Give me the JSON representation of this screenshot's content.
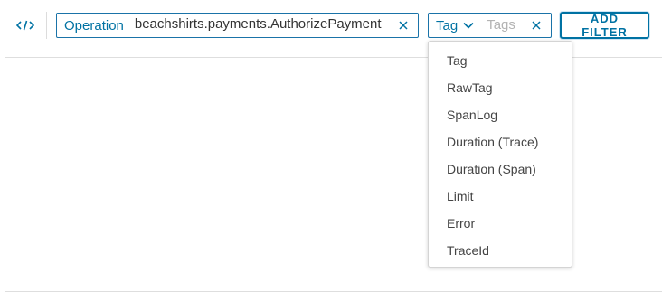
{
  "toolbar": {
    "code_icon": "code-brackets-icon",
    "operation_chip": {
      "key": "Operation",
      "value": "beachshirts.payments.AuthorizePayment",
      "close_icon": "close-icon"
    },
    "tag_chip": {
      "key": "Tag",
      "dropdown_icon": "chevron-down-icon",
      "input_value": "",
      "input_placeholder": "Tags",
      "close_icon": "close-icon"
    },
    "add_filter_label": "ADD FILTER"
  },
  "dropdown": {
    "items": [
      {
        "label": "Tag"
      },
      {
        "label": "RawTag"
      },
      {
        "label": "SpanLog"
      },
      {
        "label": "Duration (Trace)"
      },
      {
        "label": "Duration (Span)"
      },
      {
        "label": "Limit"
      },
      {
        "label": "Error"
      },
      {
        "label": "TraceId"
      }
    ]
  },
  "colors": {
    "accent": "#0072a3",
    "border": "#dedede",
    "text": "#333333"
  }
}
